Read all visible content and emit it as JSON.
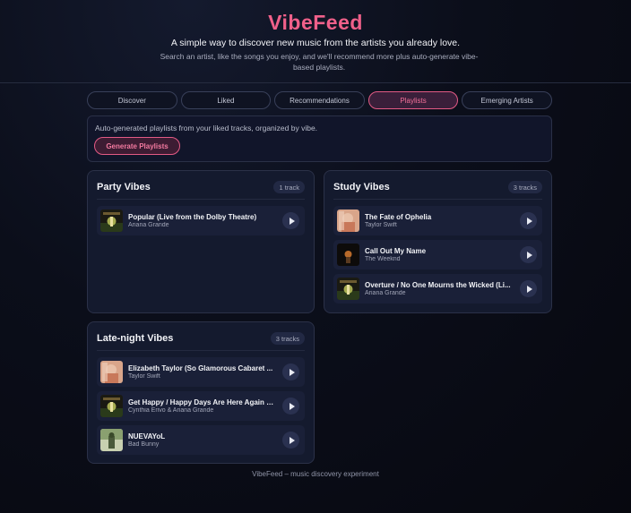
{
  "header": {
    "brand": "VibeFeed",
    "tagline": "A simple way to discover new music from the artists you already love.",
    "subtext": "Search an artist, like the songs you enjoy, and we'll recommend more plus auto-generate vibe-based playlists."
  },
  "tabs": [
    {
      "label": "Discover",
      "active": false
    },
    {
      "label": "Liked",
      "active": false
    },
    {
      "label": "Recommendations",
      "active": false
    },
    {
      "label": "Playlists",
      "active": true
    },
    {
      "label": "Emerging Artists",
      "active": false
    }
  ],
  "info": {
    "text": "Auto-generated playlists from your liked tracks, organized by vibe.",
    "button_label": "Generate Playlists"
  },
  "playlists": {
    "party": {
      "title": "Party Vibes",
      "count": "1 track",
      "tracks": [
        {
          "title": "Popular (Live from the Dolby Theatre)",
          "artist": "Ariana Grande",
          "cover": "wicked"
        }
      ]
    },
    "study": {
      "title": "Study Vibes",
      "count": "3 tracks",
      "tracks": [
        {
          "title": "The Fate of Ophelia",
          "artist": "Taylor Swift",
          "cover": "showgirl"
        },
        {
          "title": "Call Out My Name",
          "artist": "The Weeknd",
          "cover": "dark"
        },
        {
          "title": "Overture / No One Mourns the Wicked (Li...",
          "artist": "Ariana Grande",
          "cover": "wicked"
        }
      ]
    },
    "latenight": {
      "title": "Late-night Vibes",
      "count": "3 tracks",
      "tracks": [
        {
          "title": "Elizabeth Taylor (So Glamorous Cabaret ...",
          "artist": "Taylor Swift",
          "cover": "showgirl"
        },
        {
          "title": "Get Happy / Happy Days Are Here Again (...",
          "artist": "Cynthia Erivo & Ariana Grande",
          "cover": "wicked"
        },
        {
          "title": "NUEVAYoL",
          "artist": "Bad Bunny",
          "cover": "forest"
        }
      ]
    }
  },
  "footer": "VibeFeed – music discovery experiment",
  "colors": {
    "accent": "#f0608a",
    "background": "#0b0e1a",
    "card": "#141a2e"
  },
  "icons": {
    "play": "play-icon"
  }
}
